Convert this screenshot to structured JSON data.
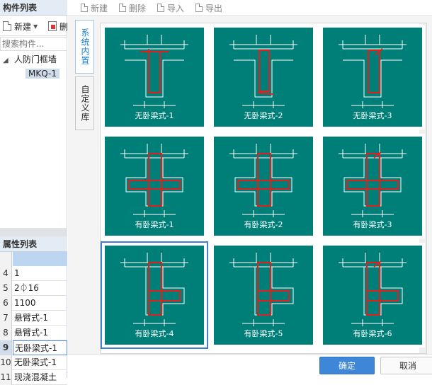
{
  "component_panel": {
    "title": "构件列表",
    "new_label": "新建",
    "delete_label": "删",
    "search_placeholder": "搜索构件...",
    "tree": {
      "group": "人防门框墙",
      "item": "MKQ-1"
    }
  },
  "property_panel": {
    "title": "属性列表",
    "rows": [
      {
        "num": "4",
        "value": "1"
      },
      {
        "num": "5",
        "value": "2⏀16"
      },
      {
        "num": "6",
        "value": "1100"
      },
      {
        "num": "7",
        "value": "悬臂式-1"
      },
      {
        "num": "8",
        "value": "悬臂式-1"
      },
      {
        "num": "9",
        "value": "无卧梁式-1"
      },
      {
        "num": "10",
        "value": "无卧梁式-1"
      },
      {
        "num": "11",
        "value": "现浇混凝土"
      }
    ],
    "selected_row": "9"
  },
  "toolbar": {
    "new_label": "新建",
    "delete_label": "删除",
    "import_label": "导入",
    "export_label": "导出"
  },
  "tabs": [
    {
      "label": "系统内置",
      "active": true
    },
    {
      "label": "自定义库",
      "active": false
    }
  ],
  "thumbnails": [
    {
      "label": "无卧梁式-1",
      "kind": "no-beam",
      "variant": 1
    },
    {
      "label": "无卧梁式-2",
      "kind": "no-beam",
      "variant": 2
    },
    {
      "label": "无卧梁式-3",
      "kind": "no-beam",
      "variant": 3
    },
    {
      "label": "有卧梁式-1",
      "kind": "beam",
      "variant": 1
    },
    {
      "label": "有卧梁式-2",
      "kind": "beam",
      "variant": 2
    },
    {
      "label": "有卧梁式-3",
      "kind": "beam",
      "variant": 3
    },
    {
      "label": "有卧梁式-4",
      "kind": "side-beam",
      "variant": 1
    },
    {
      "label": "有卧梁式-5",
      "kind": "side-beam",
      "variant": 2
    },
    {
      "label": "有卧梁式-6",
      "kind": "side-beam",
      "variant": 3
    }
  ],
  "selected_thumbnail": "有卧梁式-4",
  "buttons": {
    "ok": "确定",
    "cancel": "取消"
  },
  "colors": {
    "thumb_bg": "#007e78",
    "rebar": "#e0201c",
    "line": "#ffffff",
    "accent": "#3d86d8"
  }
}
